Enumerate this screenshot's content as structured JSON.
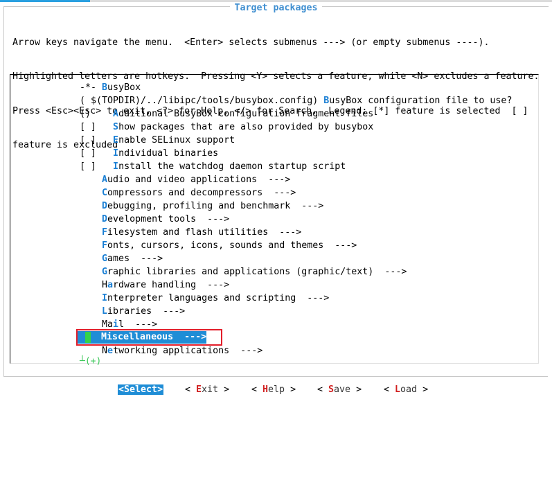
{
  "dialog": {
    "title": "Target packages",
    "help_lines": [
      "Arrow keys navigate the menu.  <Enter> selects submenus ---> (or empty submenus ----).",
      "Highlighted letters are hotkeys.  Pressing <Y> selects a feature, while <N> excludes a feature.",
      "Press <Esc><Esc> to exit, <?> for Help, </> for Search.  Legend: [*] feature is selected  [ ]",
      "feature is excluded"
    ]
  },
  "menu": {
    "items": [
      {
        "prefix": "-*- ",
        "hotkey": "B",
        "rest": "usyBox"
      },
      {
        "prefix": "( $(TOPDIR)/../libipc/tools/busybox.config) ",
        "hotkey": "B",
        "rest": "usyBox configuration file to use?"
      },
      {
        "prefix": "()    ",
        "hotkey": "A",
        "rest": "dditional BusyBox configuration fragment files"
      },
      {
        "prefix": "[ ]   ",
        "hotkey": "S",
        "rest": "how packages that are also provided by busybox"
      },
      {
        "prefix": "[ ]   ",
        "hotkey": "E",
        "rest": "nable SELinux support"
      },
      {
        "prefix": "[ ]   ",
        "hotkey": "I",
        "rest": "ndividual binaries"
      },
      {
        "prefix": "[ ]   ",
        "hotkey": "I",
        "rest": "nstall the watchdog daemon startup script"
      },
      {
        "prefix": "    ",
        "hotkey": "A",
        "rest": "udio and video applications  --->"
      },
      {
        "prefix": "    ",
        "hotkey": "C",
        "rest": "ompressors and decompressors  --->"
      },
      {
        "prefix": "    ",
        "hotkey": "D",
        "rest": "ebugging, profiling and benchmark  --->"
      },
      {
        "prefix": "    ",
        "hotkey": "D",
        "rest": "evelopment tools  --->"
      },
      {
        "prefix": "    ",
        "hotkey": "F",
        "rest": "ilesystem and flash utilities  --->"
      },
      {
        "prefix": "    ",
        "hotkey": "F",
        "rest": "onts, cursors, icons, sounds and themes  --->"
      },
      {
        "prefix": "    ",
        "hotkey": "G",
        "rest": "ames  --->"
      },
      {
        "prefix": "    ",
        "hotkey": "G",
        "rest": "raphic libraries and applications (graphic/text)  --->"
      },
      {
        "prefix": "    H",
        "hotkey": "a",
        "rest": "rdware handling  --->"
      },
      {
        "prefix": "    ",
        "hotkey": "I",
        "rest": "nterpreter languages and scripting  --->"
      },
      {
        "prefix": "    ",
        "hotkey": "L",
        "rest": "ibraries  --->"
      },
      {
        "prefix": "    Ma",
        "hotkey": "i",
        "rest": "l  --->"
      }
    ],
    "selected": {
      "pre": "M",
      "hotkey": "i",
      "rest": "scellaneous  --->"
    },
    "after": {
      "prefix": "    ",
      "pre": "N",
      "hotkey": "e",
      "rest": "tworking applications  --->"
    },
    "more_indicator": "┴(+)"
  },
  "buttons": [
    {
      "lt": "<",
      "pre": "",
      "hotkey": "S",
      "rest": "elect",
      "gt": ">",
      "active": true
    },
    {
      "lt": "< ",
      "pre": "",
      "hotkey": "E",
      "rest": "xit",
      "gt": " >",
      "active": false
    },
    {
      "lt": "< ",
      "pre": "",
      "hotkey": "H",
      "rest": "elp",
      "gt": " >",
      "active": false
    },
    {
      "lt": "< ",
      "pre": "",
      "hotkey": "S",
      "rest": "ave",
      "gt": " >",
      "active": false
    },
    {
      "lt": "< ",
      "pre": "",
      "hotkey": "L",
      "rest": "oad",
      "gt": " >",
      "active": false
    }
  ],
  "colors": {
    "title": "#3e8ed0",
    "hotkey": "#1a7fd4",
    "selection": "#1f8dd6",
    "cursor_marker": "#34d34a",
    "highlight_box": "#e31e2a",
    "button_hotkey": "#d12020",
    "more_indicator": "#3cc85a"
  }
}
